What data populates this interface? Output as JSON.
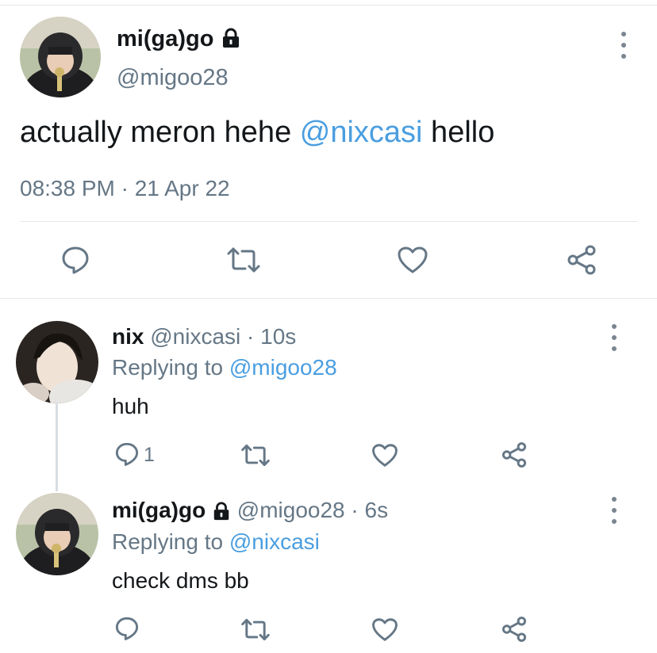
{
  "main_tweet": {
    "display_name": "mi(ga)go",
    "handle": "@migoo28",
    "text_before": "actually meron hehe ",
    "mention": "@nixcasi",
    "text_after": " hello",
    "timestamp": "08:38 PM · 21 Apr 22"
  },
  "replies": [
    {
      "display_name": "nix",
      "handle": "@nixcasi",
      "time": "· 10s",
      "replying_prefix": "Replying to ",
      "replying_to": "@migoo28",
      "text": "huh",
      "reply_count": "1"
    },
    {
      "display_name": "mi(ga)go",
      "handle": "@migoo28",
      "time": "· 6s",
      "replying_prefix": "Replying to ",
      "replying_to": "@nixcasi",
      "text": "check dms bb"
    }
  ],
  "icons": {
    "reply": "reply-icon",
    "retweet": "retweet-icon",
    "like": "heart-icon",
    "share": "share-icon",
    "lock": "lock-icon",
    "more": "more-icon"
  },
  "colors": {
    "accent": "#4a9ee0",
    "text": "#14171a",
    "secondary": "#657786",
    "divider": "#e1e8ed"
  }
}
